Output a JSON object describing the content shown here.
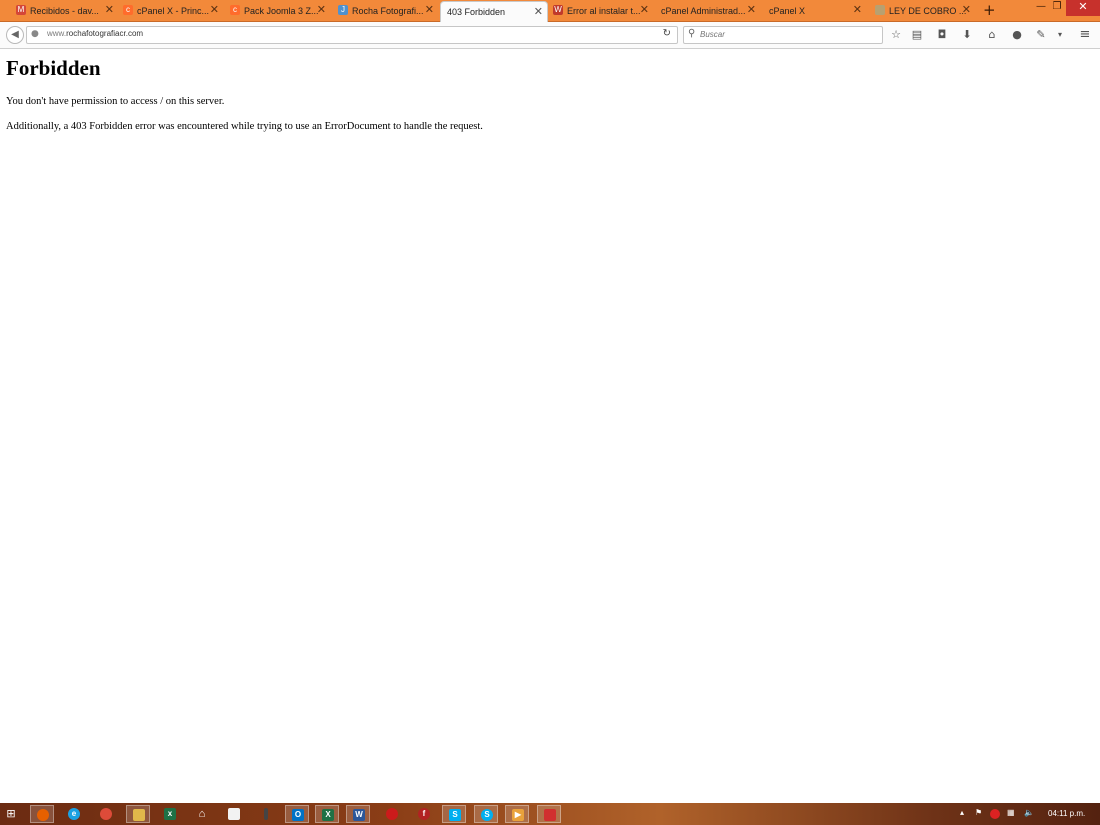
{
  "tabs": [
    {
      "label": "Recibidos - dav...",
      "icon": "gmail-icon",
      "color": "#d44638"
    },
    {
      "label": "cPanel X - Princ...",
      "icon": "cpanel-icon",
      "color": "#ff6c2c"
    },
    {
      "label": "Pack Joomla 3 Z...",
      "icon": "cpanel-icon",
      "color": "#ff6c2c"
    },
    {
      "label": "Rocha Fotografi...",
      "icon": "joomla-icon",
      "color": "#5091cd"
    },
    {
      "label": "403 Forbidden",
      "icon": "",
      "color": ""
    },
    {
      "label": "Error al instalar t...",
      "icon": "wordpress-icon",
      "color": "#c0392b"
    },
    {
      "label": "cPanel Administrad...",
      "icon": "",
      "color": ""
    },
    {
      "label": "cPanel X",
      "icon": "",
      "color": ""
    },
    {
      "label": "LEY DE COBRO ...",
      "icon": "document-icon",
      "color": "#b8a070"
    }
  ],
  "active_tab_index": 4,
  "navbar": {
    "url_prefix": "www.",
    "url_domain": "rochafotografiacr.com",
    "search_placeholder": "Buscar"
  },
  "page": {
    "title": "Forbidden",
    "message1": "You don't have permission to access / on this server.",
    "message2": "Additionally, a 403 Forbidden error was encountered while trying to use an ErrorDocument to handle the request."
  },
  "taskbar": {
    "clock": "04:11 p.m.",
    "apps": [
      {
        "icon": "firefox-icon",
        "color": "#e66000",
        "open": true
      },
      {
        "icon": "internet-explorer-icon",
        "color": "#1ba1e2",
        "open": false
      },
      {
        "icon": "chrome-icon",
        "color": "#dd4b39",
        "open": false
      },
      {
        "icon": "file-explorer-icon",
        "color": "#e0b84a",
        "open": true
      },
      {
        "icon": "excel-icon",
        "color": "#1e7145",
        "open": false
      },
      {
        "icon": "home-icon",
        "color": "#555555",
        "open": false
      },
      {
        "icon": "notepad-icon",
        "color": "#dddddd",
        "open": false
      },
      {
        "icon": "app-icon",
        "color": "#444444",
        "open": false
      },
      {
        "icon": "outlook-icon",
        "color": "#0072c6",
        "open": true
      },
      {
        "icon": "excel-icon",
        "color": "#1e7145",
        "open": true
      },
      {
        "icon": "word-icon",
        "color": "#2b579a",
        "open": true
      },
      {
        "icon": "opera-icon",
        "color": "#cc1b1b",
        "open": false
      },
      {
        "icon": "filezilla-icon",
        "color": "#b22222",
        "open": false
      },
      {
        "icon": "skype-icon",
        "color": "#00aff0",
        "open": true
      },
      {
        "icon": "skype-icon",
        "color": "#00aff0",
        "open": true
      },
      {
        "icon": "media-player-icon",
        "color": "#e9a23b",
        "open": true
      },
      {
        "icon": "acrobat-icon",
        "color": "#d12f2f",
        "open": true
      }
    ]
  }
}
